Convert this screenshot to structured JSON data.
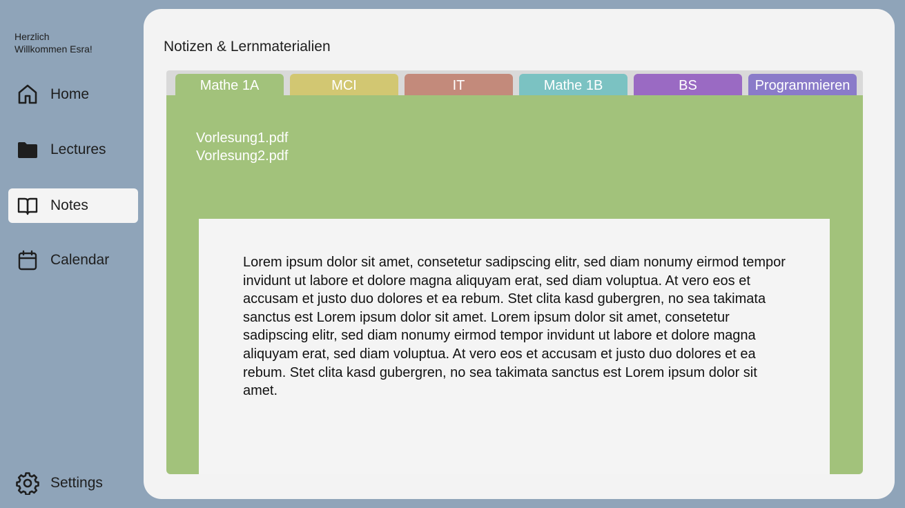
{
  "sidebar": {
    "welcome_line1": "Herzlich",
    "welcome_line2": "Willkommen Esra!",
    "items": [
      {
        "label": "Home",
        "icon": "home-icon"
      },
      {
        "label": "Lectures",
        "icon": "folder-icon"
      },
      {
        "label": "Notes",
        "icon": "book-icon",
        "active": true
      },
      {
        "label": "Calendar",
        "icon": "calendar-icon"
      }
    ],
    "settings_label": "Settings"
  },
  "main": {
    "title": "Notizen & Lernmaterialien",
    "tabs": [
      {
        "label": "Mathe 1A",
        "color": "#a2c27b",
        "active": true
      },
      {
        "label": "MCI",
        "color": "#d2c772"
      },
      {
        "label": "IT",
        "color": "#c38a7b"
      },
      {
        "label": "Mathe 1B",
        "color": "#7bc2c2"
      },
      {
        "label": "BS",
        "color": "#9a6ac3"
      },
      {
        "label": "Programmieren",
        "color": "#8a7bc9"
      }
    ],
    "files": [
      "Vorlesung1.pdf",
      "Vorlesung2.pdf"
    ],
    "note_text": "Lorem ipsum dolor sit amet, consetetur sadipscing elitr, sed diam nonumy eirmod tempor invidunt ut labore et dolore magna aliquyam erat, sed diam voluptua. At vero eos et accusam et justo duo dolores et ea rebum. Stet clita kasd gubergren, no sea takimata sanctus est Lorem ipsum dolor sit amet. Lorem ipsum dolor sit amet, consetetur sadipscing elitr, sed diam nonumy eirmod tempor invidunt ut labore et dolore magna aliquyam erat, sed diam voluptua. At vero eos et accusam et justo duo dolores et ea rebum. Stet clita kasd gubergren, no sea takimata sanctus est Lorem ipsum dolor sit amet."
  },
  "colors": {
    "app_background": "#8fa4b9",
    "card_background": "#f3f3f3",
    "active_panel": "#a2c27b"
  }
}
